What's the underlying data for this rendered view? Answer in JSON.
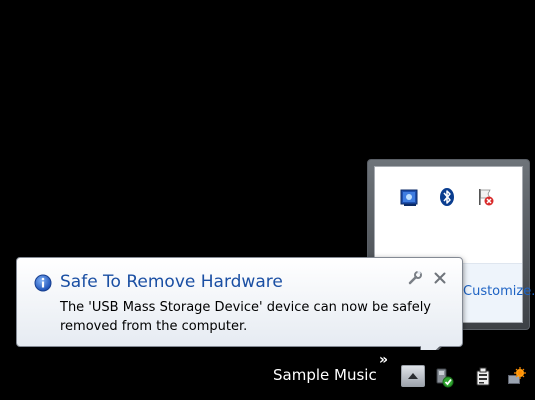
{
  "balloon": {
    "title": "Safe To Remove Hardware",
    "message_line1": "The 'USB Mass Storage Device' device can now be safely",
    "message_line2": "removed from the computer.",
    "icon": "info-icon"
  },
  "overflow": {
    "icons": [
      "hardware-app-icon",
      "bluetooth-icon",
      "action-center-error-flag-icon"
    ],
    "customize_link": "Customize..."
  },
  "taskbar": {
    "toolbar_label": "Sample Music",
    "toolbar_chevron": "»",
    "tray_icons": [
      "safely-remove-hardware-icon",
      "power-icon",
      "network-icon"
    ]
  }
}
